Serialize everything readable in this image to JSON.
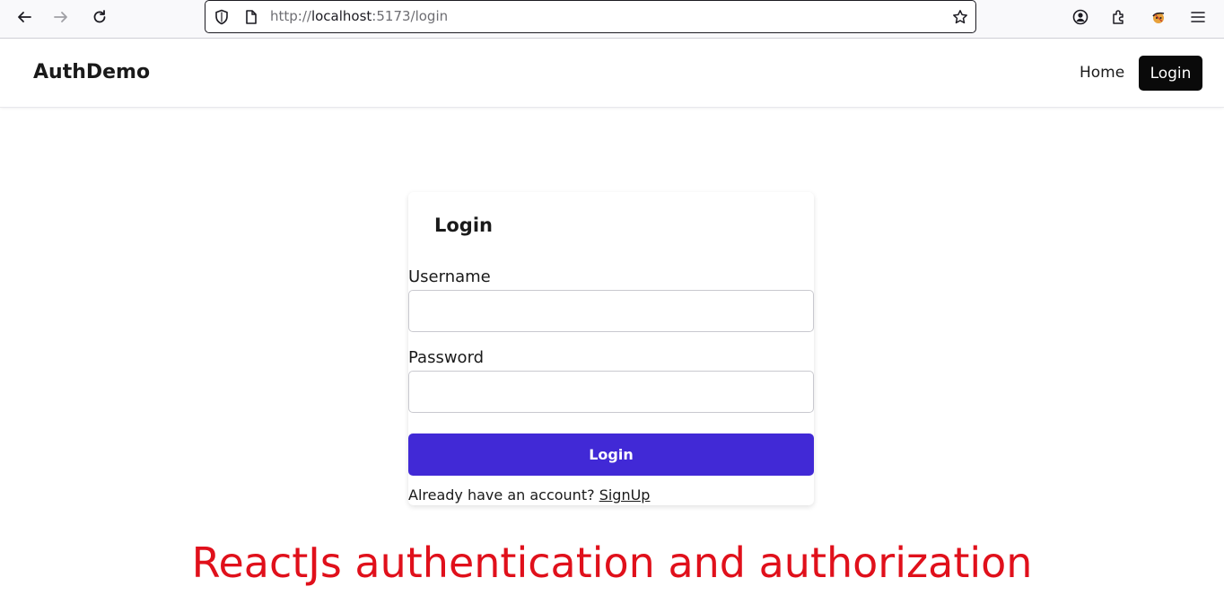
{
  "browser": {
    "url_scheme": "http://",
    "url_host": "localhost",
    "url_rest": ":5173/login"
  },
  "header": {
    "brand": "AuthDemo",
    "nav_home": "Home",
    "nav_login": "Login"
  },
  "card": {
    "title": "Login",
    "username_label": "Username",
    "username_value": "",
    "password_label": "Password",
    "password_value": "",
    "submit_label": "Login",
    "footer_text": "Already have an account?",
    "footer_link": "SignUp"
  },
  "caption": "ReactJs authentication and authorization",
  "colors": {
    "primary_button": "#4129d6",
    "caption": "#e0101b",
    "nav_login_bg": "#0a0a0a"
  },
  "icons": {
    "back": "back-arrow-icon",
    "forward": "forward-arrow-icon",
    "reload": "reload-icon",
    "shield": "shield-icon",
    "page": "page-icon",
    "bookmark": "star-icon",
    "account": "account-icon",
    "extensions": "puzzle-icon",
    "profile": "profile-avatar-icon",
    "menu": "hamburger-menu-icon"
  }
}
